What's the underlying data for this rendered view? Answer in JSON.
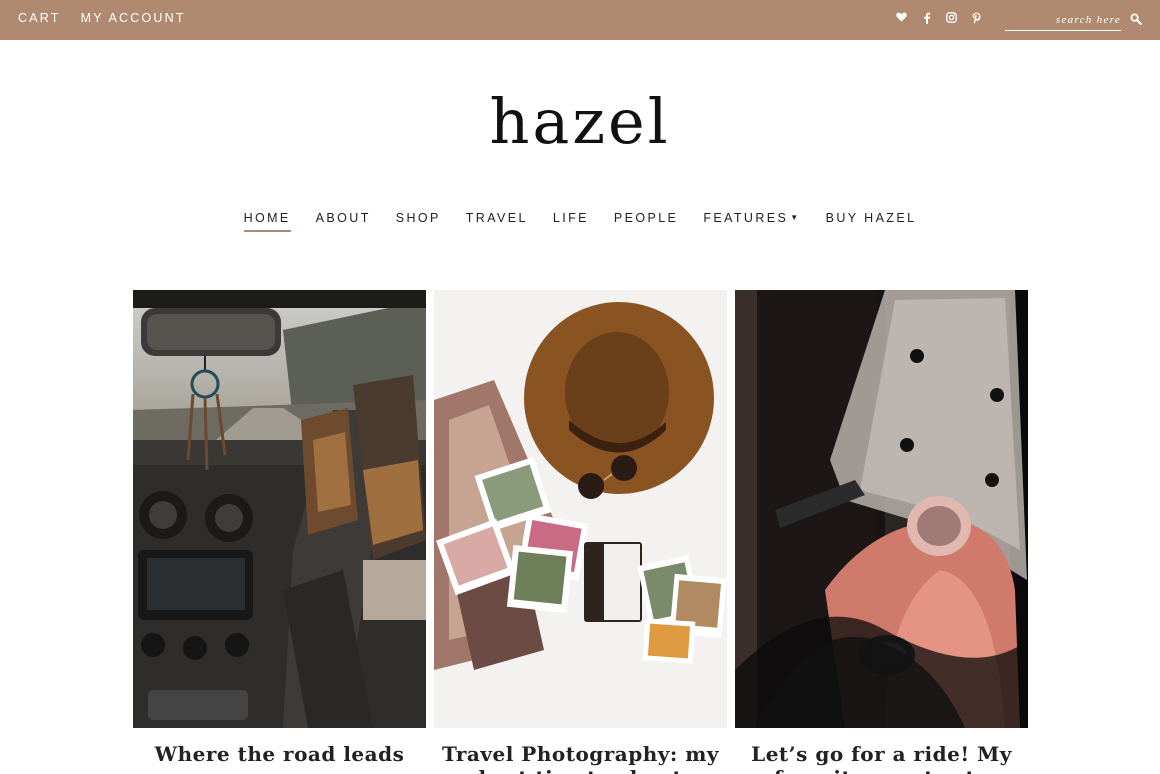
{
  "topbar": {
    "cart": "CART",
    "account": "MY ACCOUNT",
    "social": [
      "heart-icon",
      "facebook-icon",
      "instagram-icon",
      "pinterest-icon"
    ],
    "search_placeholder": "search here",
    "background": "#b08a70"
  },
  "logo": "hazel",
  "nav": {
    "items": [
      {
        "label": "HOME",
        "active": true
      },
      {
        "label": "ABOUT"
      },
      {
        "label": "SHOP"
      },
      {
        "label": "TRAVEL"
      },
      {
        "label": "LIFE"
      },
      {
        "label": "PEOPLE"
      },
      {
        "label": "FEATURES",
        "dropdown": true
      },
      {
        "label": "BUY HAZEL"
      }
    ],
    "accent": "#b08a70"
  },
  "posts": [
    {
      "title": "Where the road leads you",
      "image": "car-road-trip-photo"
    },
    {
      "title": "Travel Photography: my best tips to shoot",
      "image": "hat-and-polaroids-flatlay-photo"
    },
    {
      "title": "Let’s go for a ride! My favorite scooter to",
      "image": "pink-scooter-photo"
    }
  ]
}
